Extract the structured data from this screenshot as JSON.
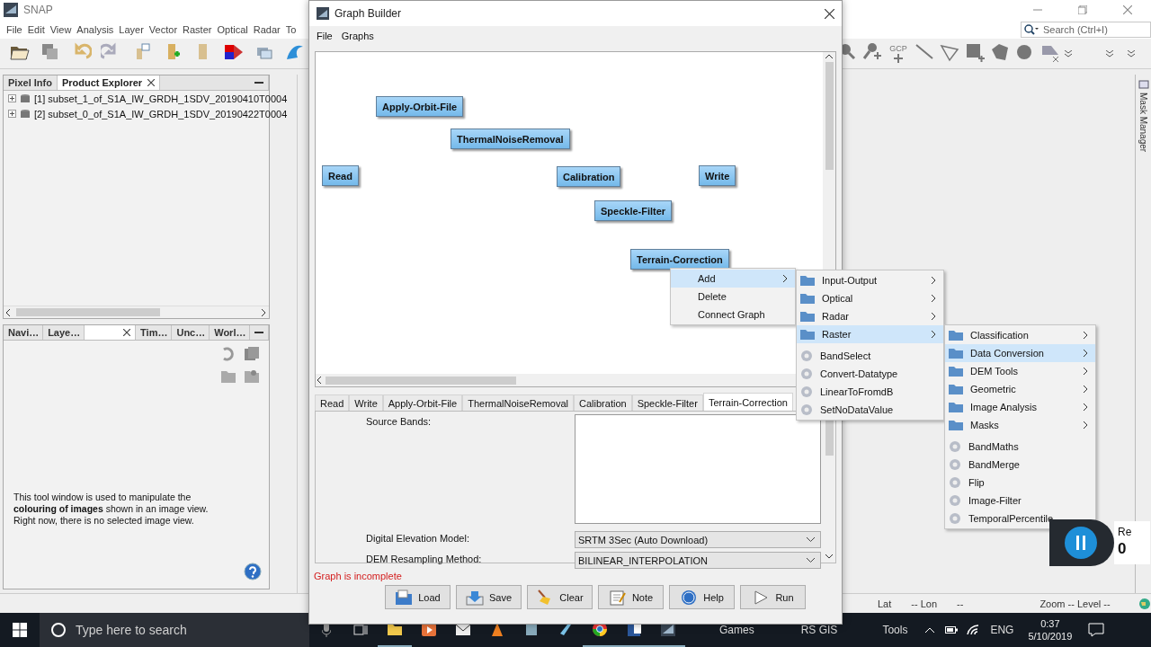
{
  "snap": {
    "title": "SNAP",
    "menu": [
      "File",
      "Edit",
      "View",
      "Analysis",
      "Layer",
      "Vector",
      "Raster",
      "Optical",
      "Radar",
      "To"
    ],
    "search": {
      "placeholder": "Search (Ctrl+I)"
    },
    "gcp_label": "GCP",
    "top_tabs": [
      {
        "label": "Pixel Info",
        "selected": false,
        "closable": false
      },
      {
        "label": "Product Explorer",
        "selected": true,
        "closable": true
      }
    ],
    "products": [
      "[1] subset_1_of_S1A_IW_GRDH_1SDV_20190410T0004",
      "[2] subset_0_of_S1A_IW_GRDH_1SDV_20190422T0004"
    ],
    "bottom_tabs": [
      {
        "label": "Navi…",
        "selected": false,
        "closable": false
      },
      {
        "label": "Laye…",
        "selected": false,
        "closable": false
      },
      {
        "selected": true,
        "closable": true
      },
      {
        "label": "Tim…",
        "selected": false,
        "closable": false
      },
      {
        "label": "Unc…",
        "selected": false,
        "closable": false
      },
      {
        "label": "Worl…",
        "selected": false,
        "closable": false
      }
    ],
    "help_text": "This tool window is used to manipulate the **colouring of images** shown in an image view. Right now, there is no selected image view.",
    "side_tab": "Mask Manager",
    "status": [
      "Lat",
      "-- Lon",
      "--",
      "Zoom -- Level --"
    ]
  },
  "graph_builder": {
    "title": "Graph Builder",
    "menu": [
      "File",
      "Graphs"
    ],
    "nodes": [
      {
        "label": "Apply-Orbit-File"
      },
      {
        "label": "ThermalNoiseRemoval"
      },
      {
        "label": "Read"
      },
      {
        "label": "Calibration"
      },
      {
        "label": "Write"
      },
      {
        "label": "Speckle-Filter"
      },
      {
        "label": "Terrain-Correction"
      }
    ],
    "tabs": [
      {
        "label": "Read",
        "selected": false
      },
      {
        "label": "Write",
        "selected": false
      },
      {
        "label": "Apply-Orbit-File",
        "selected": false
      },
      {
        "label": "ThermalNoiseRemoval",
        "selected": false
      },
      {
        "label": "Calibration",
        "selected": false
      },
      {
        "label": "Speckle-Filter",
        "selected": false
      },
      {
        "label": "Terrain-Correction",
        "selected": true
      }
    ],
    "fields": [
      {
        "label": "Source Bands:",
        "kind": "list"
      },
      {
        "label": "Digital Elevation Model:",
        "kind": "select",
        "value": "SRTM 3Sec (Auto Download)"
      },
      {
        "label": "DEM Resampling Method:",
        "kind": "select",
        "value": "BILINEAR_INTERPOLATION"
      }
    ],
    "status": "Graph is incomplete",
    "buttons": [
      {
        "label": "Load",
        "kind": "load"
      },
      {
        "label": "Save",
        "kind": "save"
      },
      {
        "label": "Clear",
        "kind": "clear"
      },
      {
        "label": "Note",
        "kind": "note"
      },
      {
        "label": "Help",
        "kind": "help"
      },
      {
        "label": "Run",
        "kind": "run"
      }
    ]
  },
  "context_menu": [
    {
      "label": "Add",
      "submenu": true,
      "selected": true
    },
    {
      "label": "Delete",
      "submenu": false,
      "selected": false
    },
    {
      "label": "Connect Graph",
      "submenu": false,
      "selected": false
    }
  ],
  "add_menu": [
    {
      "label": "Input-Output",
      "kind": "folder",
      "submenu": true,
      "selected": false
    },
    {
      "label": "Optical",
      "kind": "folder",
      "submenu": true,
      "selected": false
    },
    {
      "label": "Radar",
      "kind": "folder",
      "submenu": true,
      "selected": false
    },
    {
      "label": "Raster",
      "kind": "folder",
      "submenu": true,
      "selected": true
    },
    {
      "label": "BandSelect",
      "kind": "operator",
      "submenu": false,
      "selected": false
    },
    {
      "label": "Convert-Datatype",
      "kind": "operator",
      "submenu": false,
      "selected": false
    },
    {
      "label": "LinearToFromdB",
      "kind": "operator",
      "submenu": false,
      "selected": false
    },
    {
      "label": "SetNoDataValue",
      "kind": "operator",
      "submenu": false,
      "selected": false
    }
  ],
  "raster_menu": [
    {
      "label": "Classification",
      "kind": "folder",
      "submenu": true,
      "selected": false
    },
    {
      "label": "Data Conversion",
      "kind": "folder",
      "submenu": true,
      "selected": true
    },
    {
      "label": "DEM Tools",
      "kind": "folder",
      "submenu": true,
      "selected": false
    },
    {
      "label": "Geometric",
      "kind": "folder",
      "submenu": true,
      "selected": false
    },
    {
      "label": "Image Analysis",
      "kind": "folder",
      "submenu": true,
      "selected": false
    },
    {
      "label": "Masks",
      "kind": "folder",
      "submenu": true,
      "selected": false
    },
    {
      "label": "BandMaths",
      "kind": "operator",
      "submenu": false,
      "selected": false
    },
    {
      "label": "BandMerge",
      "kind": "operator",
      "submenu": false,
      "selected": false
    },
    {
      "label": "Flip",
      "kind": "operator",
      "submenu": false,
      "selected": false
    },
    {
      "label": "Image-Filter",
      "kind": "operator",
      "submenu": false,
      "selected": false
    },
    {
      "label": "TemporalPercentile",
      "kind": "operator",
      "submenu": false,
      "selected": false
    }
  ],
  "recorder": {
    "texts": [
      "Re",
      "0"
    ]
  },
  "taskbar": {
    "search": {
      "placeholder": "Type here to search"
    },
    "toolbars": [
      "Games",
      "RS GIS",
      "Tools"
    ],
    "language": "ENG",
    "time": "0:37",
    "date": "5/10/2019"
  }
}
